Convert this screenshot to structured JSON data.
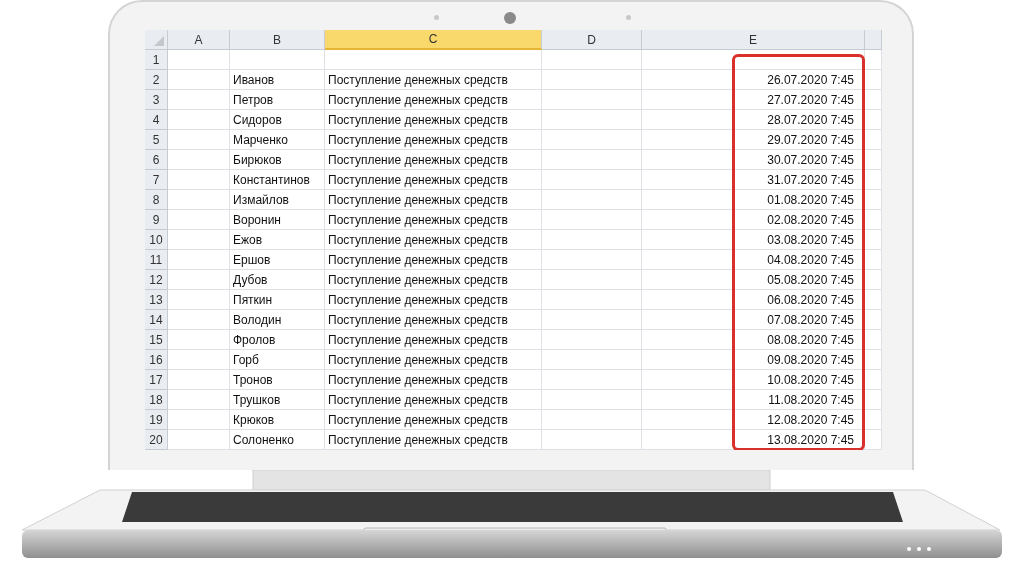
{
  "sheet": {
    "columns": [
      {
        "label": "A",
        "selected": false
      },
      {
        "label": "B",
        "selected": false
      },
      {
        "label": "C",
        "selected": true
      },
      {
        "label": "D",
        "selected": false
      },
      {
        "label": "E",
        "selected": false
      }
    ],
    "rows": [
      {
        "number": "1"
      },
      {
        "number": "2",
        "name": "Иванов",
        "operation": "Поступление денежных средств",
        "datetime": "26.07.2020 7:45"
      },
      {
        "number": "3",
        "name": "Петров",
        "operation": "Поступление денежных средств",
        "datetime": "27.07.2020 7:45"
      },
      {
        "number": "4",
        "name": "Сидоров",
        "operation": "Поступление денежных средств",
        "datetime": "28.07.2020 7:45"
      },
      {
        "number": "5",
        "name": "Марченко",
        "operation": "Поступление денежных средств",
        "datetime": "29.07.2020 7:45"
      },
      {
        "number": "6",
        "name": "Бирюков",
        "operation": "Поступление денежных средств",
        "datetime": "30.07.2020 7:45"
      },
      {
        "number": "7",
        "name": "Константинов",
        "operation": "Поступление денежных средств",
        "datetime": "31.07.2020 7:45"
      },
      {
        "number": "8",
        "name": "Измайлов",
        "operation": "Поступление денежных средств",
        "datetime": "01.08.2020 7:45"
      },
      {
        "number": "9",
        "name": "Воронин",
        "operation": "Поступление денежных средств",
        "datetime": "02.08.2020 7:45"
      },
      {
        "number": "10",
        "name": "Ежов",
        "operation": "Поступление денежных средств",
        "datetime": "03.08.2020 7:45"
      },
      {
        "number": "11",
        "name": "Ершов",
        "operation": "Поступление денежных средств",
        "datetime": "04.08.2020 7:45"
      },
      {
        "number": "12",
        "name": "Дубов",
        "operation": "Поступление денежных средств",
        "datetime": "05.08.2020 7:45"
      },
      {
        "number": "13",
        "name": "Пяткин",
        "operation": "Поступление денежных средств",
        "datetime": "06.08.2020 7:45"
      },
      {
        "number": "14",
        "name": "Володин",
        "operation": "Поступление денежных средств",
        "datetime": "07.08.2020 7:45"
      },
      {
        "number": "15",
        "name": "Фролов",
        "operation": "Поступление денежных средств",
        "datetime": "08.08.2020 7:45"
      },
      {
        "number": "16",
        "name": "Горб",
        "operation": "Поступление денежных средств",
        "datetime": "09.08.2020 7:45"
      },
      {
        "number": "17",
        "name": "Тронов",
        "operation": "Поступление денежных средств",
        "datetime": "10.08.2020 7:45"
      },
      {
        "number": "18",
        "name": "Трушков",
        "operation": "Поступление денежных средств",
        "datetime": "11.08.2020 7:45"
      },
      {
        "number": "19",
        "name": "Крюков",
        "operation": "Поступление денежных средств",
        "datetime": "12.08.2020 7:45"
      },
      {
        "number": "20",
        "name": "Солоненко",
        "operation": "Поступление денежных средств",
        "datetime": "13.08.2020 7:45"
      }
    ]
  }
}
